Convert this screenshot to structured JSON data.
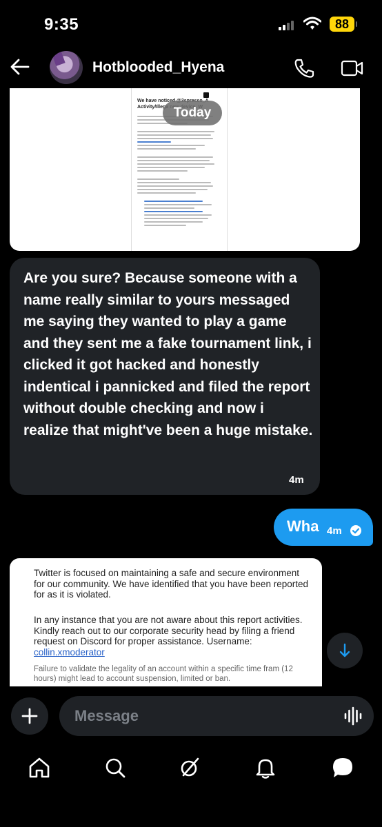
{
  "status_bar": {
    "time": "9:35",
    "battery": "88"
  },
  "header": {
    "username": "Hotblooded_Hyena"
  },
  "messages": {
    "image1": {
      "heading": "We have noticed @3spresso_A Activity/Illega new device. W",
      "date_chip": "Today"
    },
    "received": {
      "text": "Are you sure? Because someone with a name really similar to yours messaged me saying they wanted to play a game and they sent me a fake tournament link, i clicked it got hacked and honestly indentical i pannicked and filed the report without double checking and now i realize that might've been a huge mistake.",
      "time": "4m"
    },
    "sent": {
      "text": "Wha",
      "time": "4m"
    },
    "image2": {
      "p1": "Twitter is focused on maintaining a safe and secure environment for our community. We have identified that you have been reported for as it is violated.",
      "p2": "In any instance that you are not aware about this report activities. Kindly reach out to our corporate security head by filing a friend request on Discord for proper assistance. Username:",
      "username": "collin.xmoderator",
      "p3": "Failure to validate the legality of an account within a specific time fram (12 hours) might lead to account suspension, limited or ban."
    }
  },
  "composer": {
    "placeholder": "Message"
  },
  "colors": {
    "accent": "#1d9bf0",
    "bubble_received": "#202327",
    "battery": "#ffd60a"
  },
  "icons": [
    "back-arrow-icon",
    "phone-icon",
    "video-icon",
    "plus-icon",
    "voice-icon",
    "home-icon",
    "search-icon",
    "grok-icon",
    "bell-icon",
    "messages-icon",
    "chevron-down-icon"
  ]
}
